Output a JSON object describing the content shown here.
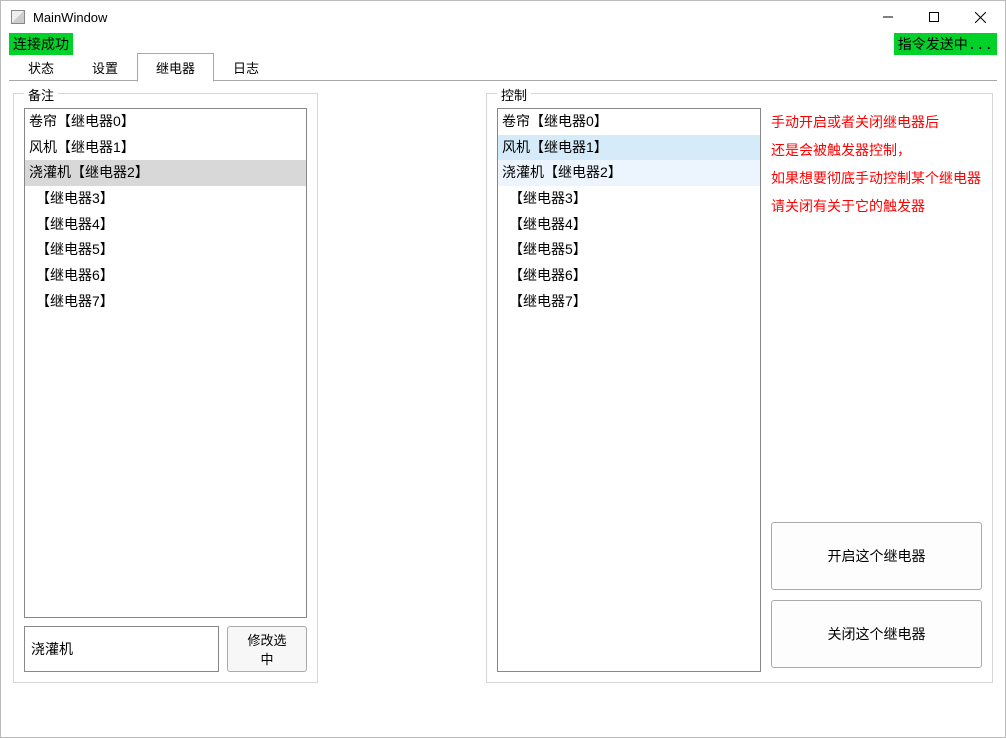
{
  "window": {
    "title": "MainWindow"
  },
  "status": {
    "connection": "连接成功",
    "sending": "指令发送中..."
  },
  "tabs": {
    "items": [
      {
        "label": "状态"
      },
      {
        "label": "设置"
      },
      {
        "label": "继电器"
      },
      {
        "label": "日志"
      }
    ],
    "active_index": 2
  },
  "remarks_group": {
    "title": "备注",
    "items": [
      "卷帘【继电器0】",
      "风机【继电器1】",
      "浇灌机【继电器2】",
      "　【继电器3】",
      "　【继电器4】",
      "　【继电器5】",
      "　【继电器6】",
      "　【继电器7】"
    ],
    "selected_index": 2,
    "edit_value": "浇灌机",
    "modify_button": "修改选中"
  },
  "control_group": {
    "title": "控制",
    "items": [
      "卷帘【继电器0】",
      "风机【继电器1】",
      "浇灌机【继电器2】",
      "　【继电器3】",
      "　【继电器4】",
      "　【继电器5】",
      "　【继电器6】",
      "　【继电器7】"
    ],
    "highlighted_indices": [
      1,
      2
    ],
    "warning_lines": [
      "手动开启或者关闭继电器后",
      "还是会被触发器控制，",
      "如果想要彻底手动控制某个继电器",
      "请关闭有关于它的触发器"
    ],
    "open_button": "开启这个继电器",
    "close_button": "关闭这个继电器"
  }
}
